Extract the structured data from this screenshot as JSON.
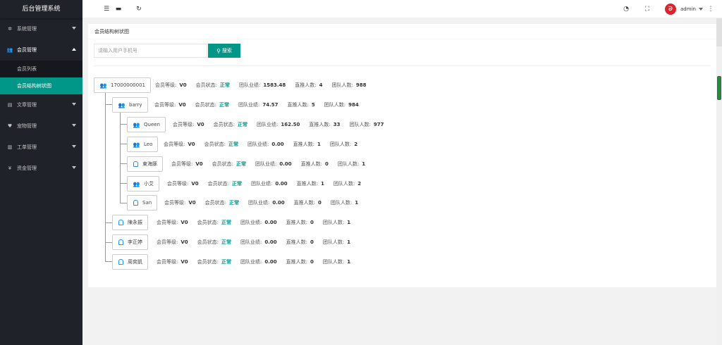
{
  "app": {
    "title": "后台管理系统"
  },
  "sidebar": {
    "items": [
      {
        "label": "系统管理",
        "icon": "gear-icon"
      },
      {
        "label": "会员管理",
        "icon": "users-icon"
      },
      {
        "label": "文章管理",
        "icon": "article-icon"
      },
      {
        "label": "宠物管理",
        "icon": "heart-icon"
      },
      {
        "label": "工单管理",
        "icon": "doc-icon"
      },
      {
        "label": "资金管理",
        "icon": "yen-icon"
      }
    ],
    "sub_items": [
      {
        "label": "会员列表"
      },
      {
        "label": "会员结构树状图"
      }
    ]
  },
  "header": {
    "user": {
      "name": "admin",
      "avatar_text": "ᘐ"
    }
  },
  "panel": {
    "title": "会员结构树状图",
    "search_placeholder": "请输入用户手机号",
    "search_button": "搜索"
  },
  "labels": {
    "level": "会员等级:",
    "status": "会员状态:",
    "perf": "团队业绩:",
    "direct": "直推人数:",
    "team": "团队人数:"
  },
  "tree": [
    {
      "name": "17000000001",
      "level": "V0",
      "status": "正常",
      "perf": "1583.48",
      "direct": "4",
      "team": "988"
    },
    {
      "name": "barry",
      "level": "V0",
      "status": "正常",
      "perf": "74.57",
      "direct": "5",
      "team": "984"
    },
    {
      "name": "Queen",
      "level": "V0",
      "status": "正常",
      "perf": "162.50",
      "direct": "33",
      "team": "977"
    },
    {
      "name": "Leo",
      "level": "V0",
      "status": "正常",
      "perf": "0.00",
      "direct": "1",
      "team": "2"
    },
    {
      "name": "東海豚",
      "level": "V0",
      "status": "正常",
      "perf": "0.00",
      "direct": "0",
      "team": "1"
    },
    {
      "name": "小艾",
      "level": "V0",
      "status": "正常",
      "perf": "0.00",
      "direct": "1",
      "team": "2"
    },
    {
      "name": "San",
      "level": "V0",
      "status": "正常",
      "perf": "0.00",
      "direct": "0",
      "team": "1"
    },
    {
      "name": "陳永振",
      "level": "V0",
      "status": "正常",
      "perf": "0.00",
      "direct": "0",
      "team": "1"
    },
    {
      "name": "李正婷",
      "level": "V0",
      "status": "正常",
      "perf": "0.00",
      "direct": "0",
      "team": "1"
    },
    {
      "name": "周奕凱",
      "level": "V0",
      "status": "正常",
      "perf": "0.00",
      "direct": "0",
      "team": "1"
    }
  ],
  "colors": {
    "accent": "#009688",
    "sidebar": "#20222a",
    "icon_blue": "#1e90ff"
  }
}
